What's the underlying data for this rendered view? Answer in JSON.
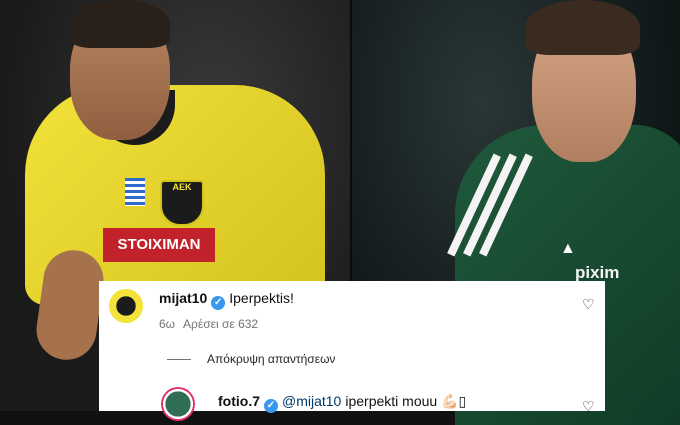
{
  "comment_main": {
    "username": "mijat10",
    "text": "Iperpektis!",
    "age": "6ω",
    "likes": "Αρέσει σε 632"
  },
  "hide_replies": "Απόκρυψη απαντήσεων",
  "reply": {
    "username": "fotio.7",
    "mention": "@mijat10",
    "text": "iperpekti mouu 💪🏻▯"
  },
  "photo_left": {
    "sponsor": "STOIXIMAN",
    "crest": "ΑΕΚ"
  },
  "photo_right": {
    "sponsor": "pixim"
  },
  "colors": {
    "verified": "#3897f0",
    "mention": "#00376b",
    "aek_yellow": "#f2e23a",
    "pao_green": "#1f5a3c"
  },
  "icons": [
    "verified-badge-icon",
    "heart-icon"
  ]
}
